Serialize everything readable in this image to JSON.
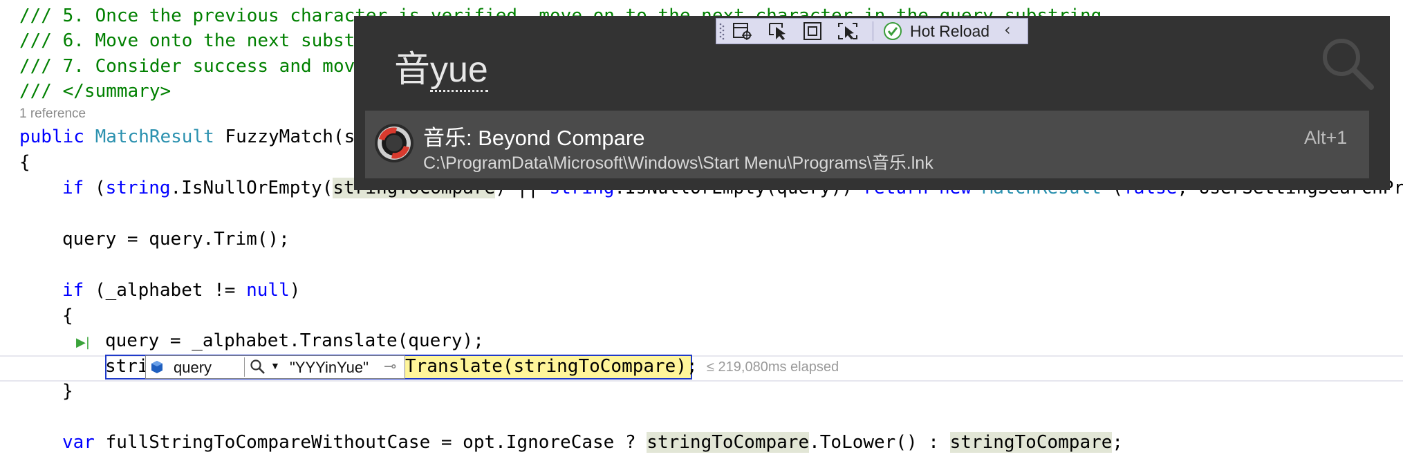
{
  "editor": {
    "comment_line5": "/// 5. Once the previous character is verified, move on to the next character in the query substring",
    "comment_line6": "/// 6. Move onto the next substr",
    "comment_line7": "/// 7. Consider success and move",
    "summary_close": "/// </summary>",
    "codelens": "1 reference",
    "sig_kw": "public",
    "sig_type": "MatchResult",
    "sig_rest": " FuzzyMatch(st",
    "brace_open": "{",
    "if1_kw": "if",
    "if1_p1": " (",
    "if1_string": "string",
    "if1_p2": ".IsNullOrEmpty(",
    "if1_arg": "stringToCompare",
    "if1_p3": ") || ",
    "if1_string2": "string",
    "if1_p4": ".IsNullOrEmpty(query)) ",
    "if1_return": "return",
    "if1_sp": " ",
    "if1_new": "new",
    "if1_sp2": " ",
    "if1_type": "MatchResult",
    "if1_p5": " (",
    "if1_false": "false",
    "if1_p6": ", UserSettingSearchPrec",
    "trim_line": "query = query.Trim();",
    "if2_kw": "if",
    "if2_p1": " (_alphabet != ",
    "if2_null": "null",
    "if2_p2": ")",
    "brace_inner_open": "{",
    "translate_line": "query = _alphabet.Translate(query);",
    "current_prefix": "stri",
    "current_suffix": "Translate(stringToCompare);",
    "brace_inner_close": "}",
    "var_kw": "var",
    "var_p1": " fullStringToCompareWithoutCase = opt.IgnoreCase ? ",
    "var_a1": "stringToCompare",
    "var_p2": ".ToLower() : ",
    "var_a2": "stringToCompare",
    "var_p3": ";",
    "elapsed": "≤ 219,080ms elapsed"
  },
  "datatip": {
    "name": "query",
    "value": "\"YYYinYue\""
  },
  "launcher": {
    "query_cjk": "音",
    "query_comp": "yue",
    "result_title": "音乐: Beyond Compare",
    "result_path": "C:\\ProgramData\\Microsoft\\Windows\\Start Menu\\Programs\\音乐.lnk",
    "result_hotkey": "Alt+1"
  },
  "debug_toolbar": {
    "hot_reload_label": "Hot Reload"
  },
  "colors": {
    "comment": "#008000",
    "keyword": "#0000ff",
    "type": "#2b91af",
    "launcher_bg": "#333333",
    "result_selected_bg": "#4b4b4b"
  }
}
